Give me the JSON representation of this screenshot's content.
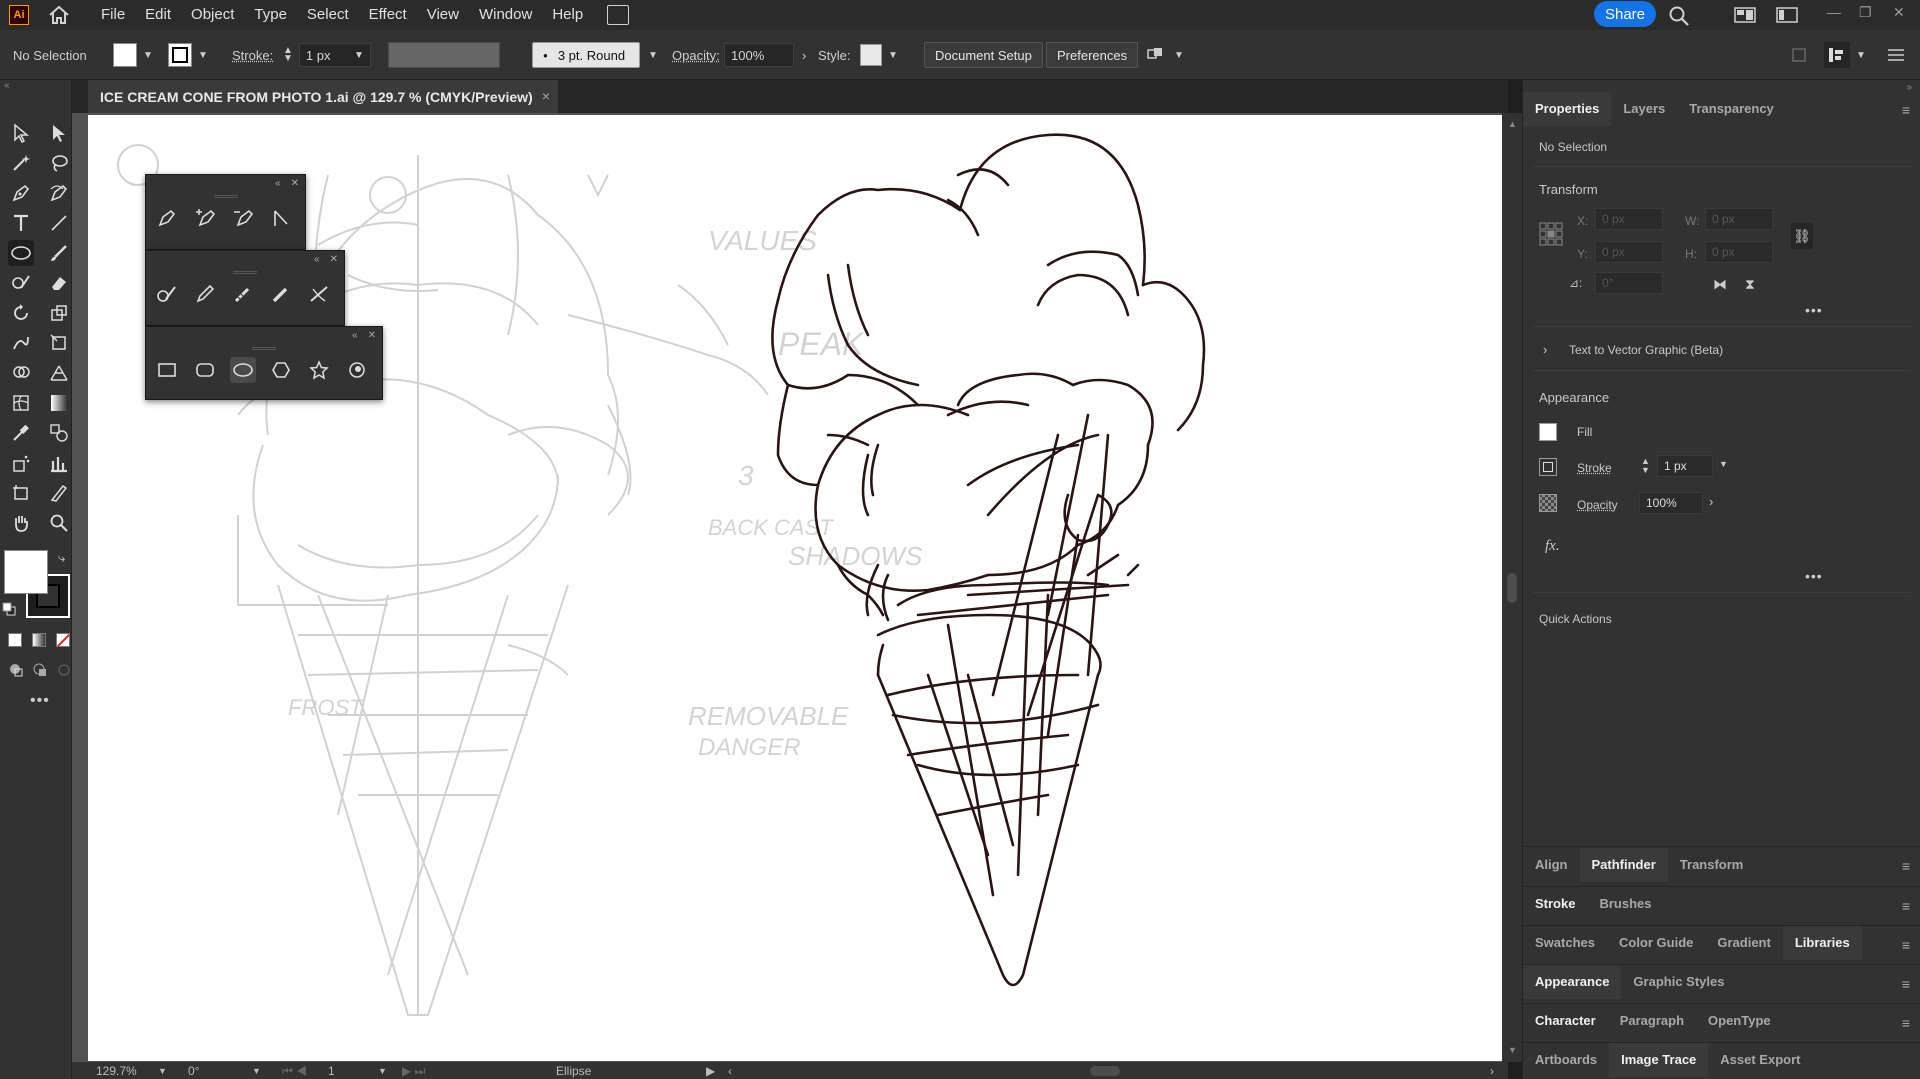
{
  "app": {
    "logo_text": "Ai",
    "menu": [
      "File",
      "Edit",
      "Object",
      "Type",
      "Select",
      "Effect",
      "View",
      "Window",
      "Help"
    ],
    "share_label": "Share",
    "accent_color": "#1473e6",
    "logo_color": "#ff9a00"
  },
  "control_bar": {
    "selection_status": "No Selection",
    "stroke_label": "Stroke:",
    "stroke_value": "1 px",
    "brush_label": "3 pt. Round",
    "opacity_label": "Opacity:",
    "opacity_value": "100%",
    "style_label": "Style:",
    "doc_setup_label": "Document Setup",
    "preferences_label": "Preferences"
  },
  "document": {
    "tab_title": "ICE CREAM CONE FROM PHOTO 1.ai @ 129.7 % (CMYK/Preview)",
    "close_glyph": "×"
  },
  "canvas": {
    "sketch_notes": [
      "VALUES",
      "PEAK",
      "3",
      "BACK CAST",
      "SHADOWS",
      "FROST",
      "REMOVABLE",
      "DANGER"
    ]
  },
  "status_bar": {
    "zoom": "129.7%",
    "rotation": "0°",
    "artboard": "1",
    "current_tool": "Ellipse"
  },
  "right_panel": {
    "tabs": [
      "Properties",
      "Layers",
      "Transparency"
    ],
    "selection": "No Selection",
    "transform": {
      "title": "Transform",
      "x_label": "X:",
      "x_value": "0 px",
      "y_label": "Y:",
      "y_value": "0 px",
      "w_label": "W:",
      "w_value": "0 px",
      "h_label": "H:",
      "h_value": "0 px",
      "angle_label": "⊿:",
      "angle_value": "0°"
    },
    "text_to_vector": "Text to Vector Graphic (Beta)",
    "appearance": {
      "title": "Appearance",
      "fill_label": "Fill",
      "stroke_label": "Stroke",
      "stroke_value": "1 px",
      "opacity_label": "Opacity",
      "opacity_value": "100%",
      "fx_label": "fx."
    },
    "quick_actions": "Quick Actions",
    "stacks": [
      {
        "tabs": [
          "Align",
          "Pathfinder",
          "Transform"
        ],
        "active": "Pathfinder"
      },
      {
        "tabs": [
          "Stroke",
          "Brushes"
        ],
        "active": "Stroke"
      },
      {
        "tabs": [
          "Swatches",
          "Color Guide",
          "Gradient",
          "Libraries"
        ],
        "active": "Libraries"
      },
      {
        "tabs": [
          "Appearance",
          "Graphic Styles"
        ],
        "active": "Appearance"
      },
      {
        "tabs": [
          "Character",
          "Paragraph",
          "OpenType"
        ],
        "active": "Character"
      },
      {
        "tabs": [
          "Artboards",
          "Image Trace",
          "Asset Export"
        ],
        "active": "Image Trace"
      }
    ]
  }
}
